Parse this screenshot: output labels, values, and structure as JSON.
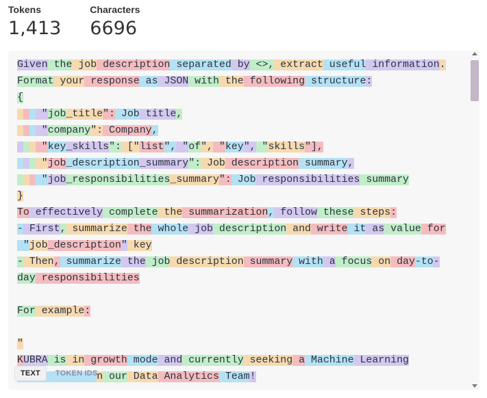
{
  "stats": {
    "tokens_label": "Tokens",
    "tokens_value": "1,413",
    "characters_label": "Characters",
    "characters_value": "6696"
  },
  "colors": [
    "#6b40d8",
    "#68de7a",
    "#f4ac36",
    "#ef4146",
    "#27b5ea"
  ],
  "lines": [
    [
      [
        "Given",
        0
      ],
      [
        " the",
        1
      ],
      [
        " job",
        2
      ],
      [
        " description",
        3
      ],
      [
        " separated",
        4
      ],
      [
        " by",
        0
      ],
      [
        " <>,",
        1
      ],
      [
        " extract",
        2
      ],
      [
        " useful",
        4
      ],
      [
        " information",
        0
      ],
      [
        ".",
        2
      ]
    ],
    [
      [
        "Format",
        1
      ],
      [
        " your",
        2
      ],
      [
        " response",
        3
      ],
      [
        " as",
        4
      ],
      [
        " JSON",
        0
      ],
      [
        " with",
        1
      ],
      [
        " the",
        2
      ],
      [
        " following",
        3
      ],
      [
        " structure",
        4
      ],
      [
        ":",
        0
      ]
    ],
    [
      [
        "{",
        1
      ]
    ],
    [
      [
        " ",
        2
      ],
      [
        " ",
        3
      ],
      [
        " ",
        4
      ],
      [
        " \"",
        0
      ],
      [
        "job",
        1
      ],
      [
        "_title",
        2
      ],
      [
        "\":",
        3
      ],
      [
        " Job",
        4
      ],
      [
        " title",
        0
      ],
      [
        ",",
        1
      ]
    ],
    [
      [
        " ",
        2
      ],
      [
        " ",
        3
      ],
      [
        " ",
        4
      ],
      [
        " \"",
        0
      ],
      [
        "company",
        1
      ],
      [
        "\":",
        2
      ],
      [
        " Company",
        3
      ],
      [
        ",",
        4
      ]
    ],
    [
      [
        " ",
        0
      ],
      [
        " ",
        1
      ],
      [
        " ",
        2
      ],
      [
        " \"",
        3
      ],
      [
        "key",
        4
      ],
      [
        "_skills",
        0
      ],
      [
        "\":",
        1
      ],
      [
        " [\"",
        2
      ],
      [
        "list",
        3
      ],
      [
        "\",",
        4
      ],
      [
        " \"",
        0
      ],
      [
        "of",
        1
      ],
      [
        "\",",
        2
      ],
      [
        " \"",
        3
      ],
      [
        "key",
        4
      ],
      [
        "\",",
        0
      ],
      [
        " \"",
        1
      ],
      [
        "skills",
        2
      ],
      [
        "\"],",
        3
      ]
    ],
    [
      [
        " ",
        4
      ],
      [
        " ",
        0
      ],
      [
        " ",
        1
      ],
      [
        " \"",
        2
      ],
      [
        "job",
        3
      ],
      [
        "_description",
        4
      ],
      [
        "_summary",
        0
      ],
      [
        "\":",
        1
      ],
      [
        " Job",
        2
      ],
      [
        " description",
        3
      ],
      [
        " summary",
        4
      ],
      [
        ",",
        0
      ]
    ],
    [
      [
        " ",
        1
      ],
      [
        " ",
        2
      ],
      [
        " ",
        3
      ],
      [
        " \"",
        4
      ],
      [
        "job",
        0
      ],
      [
        "_responsibilities",
        1
      ],
      [
        "_summary",
        2
      ],
      [
        "\":",
        3
      ],
      [
        " Job",
        4
      ],
      [
        " responsibilities",
        0
      ],
      [
        " summary",
        1
      ]
    ],
    [
      [
        "}",
        2
      ]
    ],
    [
      [
        "To",
        3
      ],
      [
        " effectively",
        0
      ],
      [
        " complete",
        1
      ],
      [
        " the",
        2
      ],
      [
        " summarization",
        3
      ],
      [
        ",",
        4
      ],
      [
        " follow",
        0
      ],
      [
        " these",
        1
      ],
      [
        " steps",
        2
      ],
      [
        ":",
        3
      ]
    ],
    [
      [
        "-",
        4
      ],
      [
        " First",
        0
      ],
      [
        ",",
        1
      ],
      [
        " summarize",
        2
      ],
      [
        " the",
        3
      ],
      [
        " whole",
        4
      ],
      [
        " job",
        0
      ],
      [
        " description",
        1
      ],
      [
        " and",
        2
      ],
      [
        " write",
        3
      ],
      [
        " it",
        4
      ],
      [
        " as",
        0
      ],
      [
        " value",
        1
      ],
      [
        " for",
        3
      ]
    ],
    [
      [
        " \"",
        4
      ],
      [
        "job",
        2
      ],
      [
        "_description",
        3
      ],
      [
        "\"",
        0
      ],
      [
        " key",
        2
      ]
    ],
    [
      [
        "-",
        1
      ],
      [
        " Then",
        2
      ],
      [
        ",",
        3
      ],
      [
        " summarize",
        4
      ],
      [
        " the",
        0
      ],
      [
        " job",
        1
      ],
      [
        " description",
        2
      ],
      [
        " summary",
        3
      ],
      [
        " with",
        4
      ],
      [
        " a",
        0
      ],
      [
        " focus",
        1
      ],
      [
        " on",
        2
      ],
      [
        " day",
        3
      ],
      [
        "-to",
        4
      ],
      [
        "-",
        0
      ]
    ],
    [
      [
        "day",
        1
      ],
      [
        " responsibilities",
        3
      ]
    ],
    [],
    [
      [
        "For",
        1
      ],
      [
        " example",
        2
      ],
      [
        ":",
        3
      ]
    ],
    [],
    [
      [
        "\"",
        2
      ]
    ],
    [
      [
        "K",
        3
      ],
      [
        "UBRA",
        0
      ],
      [
        " is",
        1
      ],
      [
        " in",
        2
      ],
      [
        " growth",
        3
      ],
      [
        " mode",
        4
      ],
      [
        " and",
        0
      ],
      [
        " currently",
        1
      ],
      [
        " seeking",
        2
      ],
      [
        " a",
        3
      ],
      [
        " Machine",
        4
      ],
      [
        " Learning",
        0
      ]
    ],
    [
      [
        "",
        1
      ],
      [
        "",
        0
      ],
      [
        "             ",
        4
      ],
      [
        "n",
        2
      ],
      [
        " our",
        1
      ],
      [
        " Data",
        2
      ],
      [
        " Analytics",
        3
      ],
      [
        " Team",
        4
      ],
      [
        "!",
        0
      ]
    ]
  ],
  "toggle": {
    "text_label": "TEXT",
    "ids_label": "TOKEN IDS"
  }
}
